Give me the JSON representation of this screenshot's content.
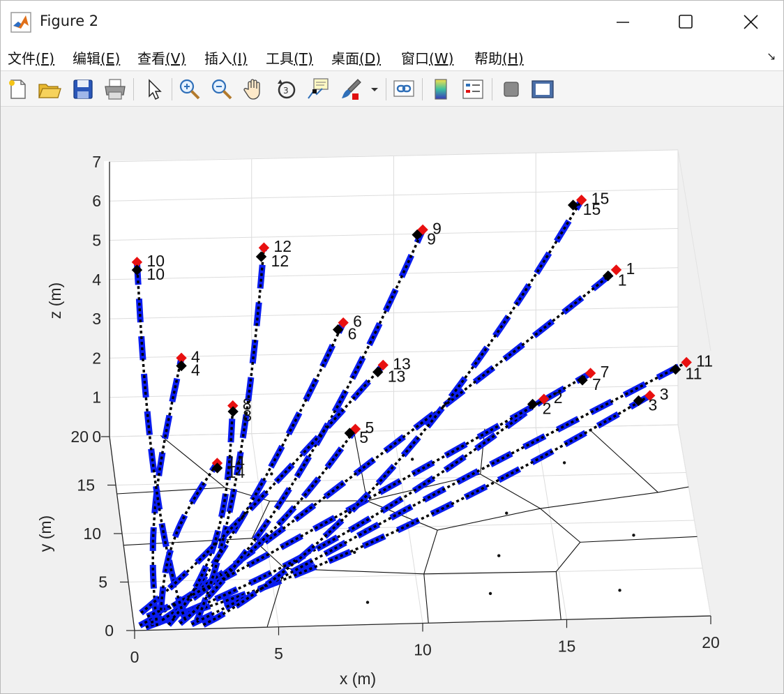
{
  "window": {
    "title": "Figure 2",
    "controls": [
      "minimize",
      "maximize",
      "close"
    ]
  },
  "menu": [
    {
      "label": "文件",
      "key": "(F)"
    },
    {
      "label": "编辑",
      "key": "(E)"
    },
    {
      "label": "查看",
      "key": "(V)"
    },
    {
      "label": "插入",
      "key": "(I)"
    },
    {
      "label": "工具",
      "key": "(T)"
    },
    {
      "label": "桌面",
      "key": "(D)"
    },
    {
      "label": "窗口",
      "key": "(W)"
    },
    {
      "label": "帮助",
      "key": "(H)"
    }
  ],
  "toolbar": [
    "new-figure-icon",
    "open-file-icon",
    "save-icon",
    "print-icon",
    "pointer-icon",
    "zoom-in-icon",
    "zoom-out-icon",
    "pan-icon",
    "rotate-3d-icon",
    "data-cursor-icon",
    "brush-icon",
    "brush-dropdown-icon",
    "link-plot-icon",
    "colorbar-icon",
    "legend-icon",
    "hide-plot-tools-icon",
    "show-plot-tools-icon"
  ],
  "colors": {
    "path_dashed": "#0a1df0",
    "path_dotted": "#000000",
    "goal_marker": "#e81010",
    "final_marker": "#000000"
  },
  "chart_data": {
    "type": "scatter",
    "xlabel": "x (m)",
    "ylabel": "y (m)",
    "zlabel": "z (m)",
    "xlim": [
      0,
      20
    ],
    "ylim": [
      0,
      20
    ],
    "zlim": [
      0,
      7
    ],
    "xticks": [
      "0",
      "5",
      "10",
      "15",
      "20"
    ],
    "yticks": [
      "0",
      "5",
      "10",
      "15",
      "20"
    ],
    "zticks": [
      "0",
      "1",
      "2",
      "3",
      "4",
      "5",
      "6",
      "7"
    ],
    "grid": true,
    "agents": [
      {
        "label": "1",
        "goal": [
          17.8,
          19.5,
          4.1
        ],
        "final": [
          17.5,
          19.3,
          4.0
        ]
      },
      {
        "label": "2",
        "goal": [
          15.0,
          14.8,
          2.0
        ],
        "final": [
          14.6,
          14.7,
          1.9
        ]
      },
      {
        "label": "3",
        "goal": [
          18.4,
          9.2,
          3.4
        ],
        "final": [
          18.0,
          9.1,
          3.3
        ]
      },
      {
        "label": "4",
        "goal": [
          2.3,
          15.0,
          3.2
        ],
        "final": [
          2.3,
          15.0,
          3.0
        ]
      },
      {
        "label": "5",
        "goal": [
          8.5,
          17.0,
          0.8
        ],
        "final": [
          8.3,
          17.0,
          0.7
        ]
      },
      {
        "label": "6",
        "goal": [
          8.2,
          19.5,
          2.9
        ],
        "final": [
          8.0,
          19.2,
          2.8
        ]
      },
      {
        "label": "7",
        "goal": [
          16.8,
          17.8,
          1.9
        ],
        "final": [
          16.5,
          17.5,
          1.8
        ]
      },
      {
        "label": "8",
        "goal": [
          4.0,
          12.8,
          2.5
        ],
        "final": [
          4.0,
          12.6,
          2.4
        ]
      },
      {
        "label": "9",
        "goal": [
          11.0,
          19.6,
          5.2
        ],
        "final": [
          10.8,
          19.5,
          5.1
        ]
      },
      {
        "label": "10",
        "goal": [
          0.9,
          18.5,
          4.8
        ],
        "final": [
          0.9,
          18.5,
          4.6
        ]
      },
      {
        "label": "11",
        "goal": [
          20.2,
          18.3,
          2.0
        ],
        "final": [
          19.8,
          18.0,
          1.9
        ]
      },
      {
        "label": "12",
        "goal": [
          5.4,
          19.3,
          4.9
        ],
        "final": [
          5.3,
          19.2,
          4.7
        ]
      },
      {
        "label": "13",
        "goal": [
          9.6,
          19.5,
          1.8
        ],
        "final": [
          9.4,
          19.2,
          1.7
        ]
      },
      {
        "label": "14",
        "goal": [
          3.5,
          13.8,
          0.8
        ],
        "final": [
          3.5,
          13.7,
          0.7
        ]
      },
      {
        "label": "15",
        "goal": [
          16.6,
          19.9,
          5.8
        ],
        "final": [
          16.3,
          19.8,
          5.7
        ]
      }
    ],
    "start_points": [
      [
        0.2,
        0.5
      ],
      [
        0.4,
        0.3
      ],
      [
        0.6,
        0.8
      ],
      [
        0.8,
        0.4
      ],
      [
        1.0,
        1.0
      ],
      [
        1.2,
        0.5
      ],
      [
        0.5,
        1.4
      ],
      [
        1.4,
        1.2
      ],
      [
        1.6,
        0.6
      ],
      [
        1.8,
        1.0
      ],
      [
        2.0,
        0.5
      ],
      [
        2.2,
        0.9
      ],
      [
        0.3,
        1.8
      ],
      [
        1.0,
        2.0
      ],
      [
        2.4,
        0.4
      ]
    ],
    "seeds": [
      [
        8.2,
        2.3
      ],
      [
        12.5,
        2.9
      ],
      [
        17.0,
        2.9
      ],
      [
        13.0,
        6.8
      ],
      [
        17.8,
        8.6
      ],
      [
        8.0,
        7.5
      ],
      [
        6.5,
        12.0
      ],
      [
        9.5,
        14.0
      ],
      [
        13.5,
        11.2
      ],
      [
        5.5,
        15.8
      ],
      [
        10.5,
        17.0
      ],
      [
        15.8,
        16.3
      ]
    ],
    "voronoi_edges": [
      [
        [
          1.8,
          20.0
        ],
        [
          3.8,
          14.5
        ]
      ],
      [
        [
          3.8,
          14.5
        ],
        [
          0.0,
          14.1
        ]
      ],
      [
        [
          3.8,
          14.5
        ],
        [
          5.3,
          13.0
        ]
      ],
      [
        [
          5.3,
          13.0
        ],
        [
          8.7,
          12.8
        ]
      ],
      [
        [
          8.7,
          12.8
        ],
        [
          8.6,
          20.0
        ]
      ],
      [
        [
          5.3,
          13.0
        ],
        [
          4.5,
          9.2
        ]
      ],
      [
        [
          4.5,
          9.2
        ],
        [
          0.0,
          8.8
        ]
      ],
      [
        [
          4.5,
          9.2
        ],
        [
          5.5,
          6.0
        ]
      ],
      [
        [
          5.5,
          6.0
        ],
        [
          10.3,
          5.1
        ]
      ],
      [
        [
          10.3,
          5.1
        ],
        [
          10.2,
          0.0
        ]
      ],
      [
        [
          5.5,
          6.0
        ],
        [
          4.6,
          0.0
        ]
      ],
      [
        [
          10.3,
          5.1
        ],
        [
          14.9,
          5.0
        ]
      ],
      [
        [
          14.9,
          5.0
        ],
        [
          14.8,
          0.0
        ]
      ],
      [
        [
          14.9,
          5.0
        ],
        [
          15.9,
          8.0
        ]
      ],
      [
        [
          15.9,
          8.0
        ],
        [
          20.0,
          8.3
        ]
      ],
      [
        [
          15.9,
          8.0
        ],
        [
          14.7,
          11.6
        ]
      ],
      [
        [
          14.7,
          11.6
        ],
        [
          11.0,
          9.6
        ]
      ],
      [
        [
          11.0,
          9.6
        ],
        [
          10.3,
          5.1
        ]
      ],
      [
        [
          11.0,
          9.6
        ],
        [
          8.7,
          12.8
        ]
      ],
      [
        [
          14.7,
          11.6
        ],
        [
          18.9,
          13.0
        ]
      ],
      [
        [
          18.9,
          13.0
        ],
        [
          20.0,
          13.5
        ]
      ],
      [
        [
          18.9,
          13.0
        ],
        [
          16.9,
          19.6
        ]
      ],
      [
        [
          14.7,
          11.6
        ],
        [
          12.8,
          15.3
        ]
      ],
      [
        [
          12.8,
          15.3
        ],
        [
          13.2,
          20.0
        ]
      ],
      [
        [
          12.8,
          15.3
        ],
        [
          8.7,
          12.8
        ]
      ]
    ]
  }
}
